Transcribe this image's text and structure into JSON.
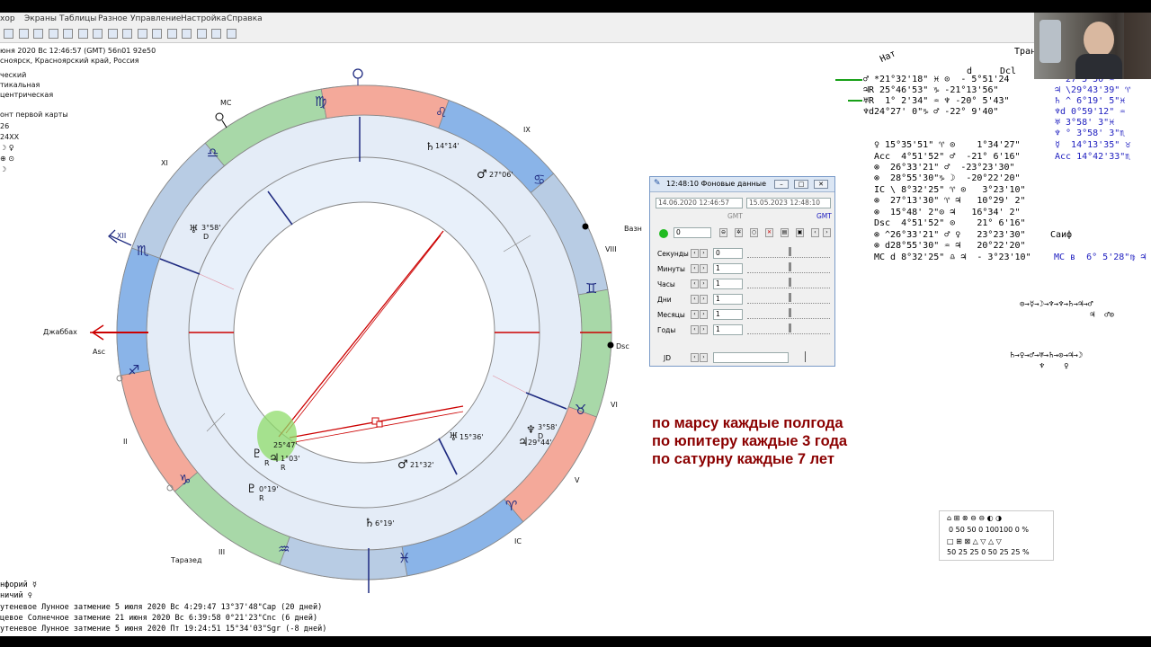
{
  "menu": [
    "хор",
    "Экраны",
    "Таблицы",
    "Разное",
    "Управление",
    "Настройка",
    "Справка"
  ],
  "toolbar_icons": [
    "save-icon",
    "globe-icon",
    "target-icon",
    "chart-icon",
    "arrow-icon",
    "grid-icon",
    "table-icon",
    "list-icon",
    "x-icon",
    "box-icon",
    "map-icon",
    "refresh-icon",
    "atom-icon",
    "print-icon",
    "tools-icon",
    "run-icon"
  ],
  "chart_info": {
    "lines": [
      "юня 2020  Вс  12:46:57 (GMT) 56n01  92e50",
      "сноярск, Красноярский край, Россия",
      "ческий",
      "тикальная",
      "центрическая",
      "",
      "онт первой карты",
      "26",
      "24XX",
      "☽ ♀",
      "⊕ ⊙",
      "☽"
    ]
  },
  "zodiac_signs": {
    "virgo": "♍",
    "leo": "♌",
    "cancer": "♋",
    "libra": "♎",
    "scorpio": "♏",
    "gemini": "♊",
    "sagittarius": "♐",
    "taurus": "♉",
    "capricorn": "♑",
    "aries": "♈",
    "aquarius": "♒",
    "pisces": "♓"
  },
  "house_labels": {
    "mc": "MC",
    "ix": "IX",
    "xi": "XI",
    "xii": "XII",
    "viii": "VIII",
    "asc": "Asc",
    "dsc": "Dsc",
    "vi": "VI",
    "ii": "II",
    "v": "V",
    "iii": "III",
    "ic": "IC"
  },
  "planets": {
    "p1": "♄",
    "p1_deg": "14°14'",
    "p2": "♂",
    "p2_deg": "27°06'",
    "p3": "♅",
    "p3_deg": "3°58'",
    "p3_mark": "D",
    "p4_deg": "25°47'",
    "p5": "♃",
    "p5_deg": "1°03'",
    "p5_mark": "R",
    "p6": "♇",
    "p6_mark": "R",
    "p7": "♆",
    "p7_deg": "3°58'",
    "p7_mark": "D",
    "p8_deg": "29°44'",
    "p9": "♅",
    "p9_deg": "15°36'",
    "p10": "♂",
    "p10_deg": "21°32'",
    "p11": "♇",
    "p11_deg": "0°19'",
    "p11_mark": "R",
    "p12": "♄",
    "p12_deg": "6°19'"
  },
  "city_labels": {
    "vazh": "Вазн",
    "dzhabbakh": "Джаббах",
    "tarazed": "Таразед",
    "saif": "Саиф"
  },
  "right_table": {
    "header_nat": "Нат",
    "header_d": "d",
    "header_dcl": "Dcl",
    "header_tran": "Тран",
    "rows1": [
      "♂ *21°32'18\" ♓ ⊙  - 5°51'24",
      "♃R 25°46'53\" ♑ -21°13'56\"",
      "♅R  1° 2'34\" ♒ ♆ -20° 5'43\"",
      "♆d24°27' 0\"♑ ♂ -22° 9'40\""
    ],
    "rows1b": [
      "  27 5'50 ♒",
      "♃ \\29°43'39\" ♈",
      "♄ ^ 6°19' 5\"♓",
      "♆d 0°59'12\" ♒",
      "♅ 3°58' 3\"♓",
      "♆ ° 3°58' 3\"♏",
      "☿  14°13'35\" ♉",
      "Асс 14°42'33\"♏"
    ],
    "rows2": [
      "♀ 15°35'51\" ♈ ⊙    1°34'27\"",
      "Асс  4°51'52\" ♂  -21° 6'16\"",
      "⊗  26°33'21\" ♂  -23°23'30\"",
      "⊗  28°55'30\"♑ ☽  -20°22'20\"",
      "IC \\ 8°32'25\" ♈ ⊙   3°23'10\"",
      "⊗  27°13'30\" ♈ ♃   10°29' 2\"",
      "⊗  15°48' 2\"⊙ ♃   16°34' 2\"",
      "Dsc  4°51'52\" ⊙    21° 6'16\"",
      "⊗ ^26°33'21\" ♂ ♀   23°23'30\"",
      "⊗ d28°55'30\" ♒ ♃   20°22'20\"",
      "MC d 8°32'25\" ♎ ♃  - 3°23'10\""
    ],
    "mc_line": "МС в  6° 5'28\"♍ ♃"
  },
  "chains": {
    "chain1": "⊙→☿→☽→♆→♆→♄→♃→♂",
    "chain1_sub": "♃  ♂⊙",
    "chain2": "♄→♀→♂→♅→♄→⊙→♃→☽",
    "chain2_sub": "♆    ♀"
  },
  "dialog": {
    "title": "12:48:10 Фоновые данные",
    "date1": "14.06.2020   12:46:57",
    "date2": "15.05.2023   12:48:10",
    "gmt1": "GMT",
    "gmt2": "GMT",
    "field": "0",
    "rows": [
      {
        "label": "Секунды",
        "value": "0"
      },
      {
        "label": "Минуты",
        "value": "1"
      },
      {
        "label": "Часы",
        "value": "1"
      },
      {
        "label": "Дни",
        "value": "1"
      },
      {
        "label": "Месяцы",
        "value": "1"
      },
      {
        "label": "Годы",
        "value": "1"
      }
    ],
    "jd_label": "JD"
  },
  "note": {
    "line1": "по марсу каждые полгода",
    "line2": "по юпитеру каждые 3 года",
    "line3": "по сатурну каждые 7 лет"
  },
  "stats": {
    "r1": "⌂ ⊞ ⊗   ⊖ ⊖ ◐ ◑",
    "r2": "0  50  50    0  100100 0 %",
    "r3": "□ ⊞ ⊠   △ ▽ △ ▽",
    "r4": "50  25  25    0  50  25  25 %"
  },
  "bottom": [
    "нфорий  ☿",
    "ничий  ♀",
    "утеневое Лунное затмение 5 июля 2020 Вс  4:29:47 13°37'48\"Cap (20 дней)",
    "цевое Солнечное затмение 21 июня 2020 Вс  6:39:58  0°21'23\"Cnc (6 дней)",
    "утеневое Лунное затмение 5 июня 2020 Пт 19:24:51 15°34'03\"Sgr (-8 дней)"
  ],
  "colors": {
    "red": "#cc0000",
    "darkred": "#8b0000",
    "blue": "#2020c0",
    "fire": "#f4a99a",
    "earth": "#a8d8a8",
    "air": "#b8cce4",
    "water": "#8ab4e8"
  }
}
